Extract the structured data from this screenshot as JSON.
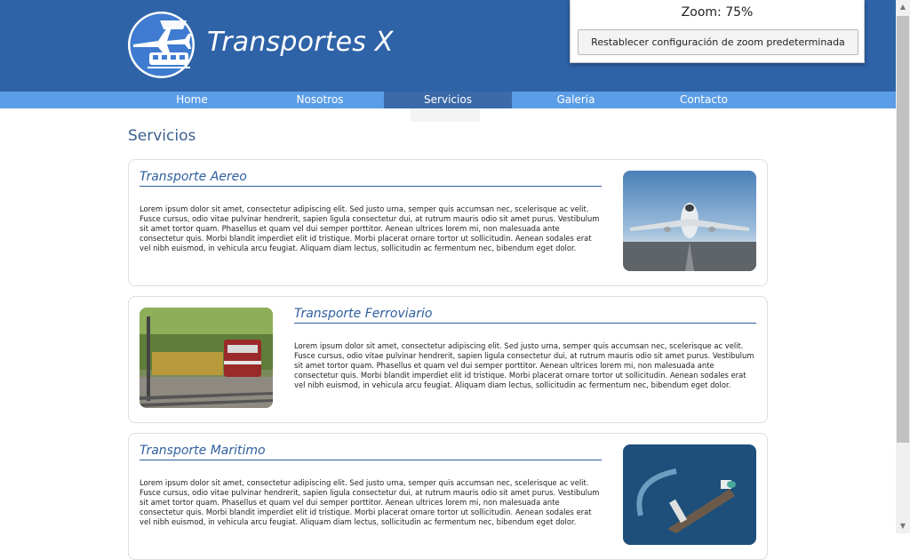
{
  "site": {
    "title": "Transportes X"
  },
  "nav": {
    "items": [
      "Home",
      "Nosotros",
      "Servicios",
      "Galeria",
      "Contacto"
    ],
    "active": "Servicios"
  },
  "page": {
    "heading": "Servicios"
  },
  "cards": [
    {
      "title": "Transporte Aereo",
      "text": "Lorem ipsum dolor sit amet, consectetur adipiscing elit. Sed justo urna, semper quis accumsan nec, scelerisque ac velit. Fusce cursus, odio vitae pulvinar hendrerit, sapien ligula consectetur dui, at rutrum mauris odio sit amet purus. Vestibulum sit amet tortor quam. Phasellus et quam vel dui semper porttitor. Aenean ultrices lorem mi, non malesuada ante consectetur quis. Morbi blandit imperdiet elit id tristique. Morbi placerat ornare tortor ut sollicitudin. Aenean sodales erat vel nibh euismod, in vehicula arcu feugiat. Aliquam diam lectus, sollicitudin ac fermentum nec, bibendum eget dolor.",
      "image": "airplane"
    },
    {
      "title": "Transporte Ferroviario",
      "text": "Lorem ipsum dolor sit amet, consectetur adipiscing elit. Sed justo urna, semper quis accumsan nec, scelerisque ac velit. Fusce cursus, odio vitae pulvinar hendrerit, sapien ligula consectetur dui, at rutrum mauris odio sit amet purus. Vestibulum sit amet tortor quam. Phasellus et quam vel dui semper porttitor. Aenean ultrices lorem mi, non malesuada ante consectetur quis. Morbi blandit imperdiet elit id tristique. Morbi placerat ornare tortor ut sollicitudin. Aenean sodales erat vel nibh euismod, in vehicula arcu feugiat. Aliquam diam lectus, sollicitudin ac fermentum nec, bibendum eget dolor.",
      "image": "train"
    },
    {
      "title": "Transporte Maritimo",
      "text": "Lorem ipsum dolor sit amet, consectetur adipiscing elit. Sed justo urna, semper quis accumsan nec, scelerisque ac velit. Fusce cursus, odio vitae pulvinar hendrerit, sapien ligula consectetur dui, at rutrum mauris odio sit amet purus. Vestibulum sit amet tortor quam. Phasellus et quam vel dui semper porttitor. Aenean ultrices lorem mi, non malesuada ante consectetur quis. Morbi blandit imperdiet elit id tristique. Morbi placerat ornare tortor ut sollicitudin. Aenean sodales erat vel nibh euismod, in vehicula arcu feugiat. Aliquam diam lectus, sollicitudin ac fermentum nec, bibendum eget dolor.",
      "image": "ship"
    }
  ],
  "zoom_popup": {
    "label": "Zoom: 75%",
    "reset_button": "Restablecer configuración de zoom predeterminada"
  },
  "colors": {
    "header": "#2f63a8",
    "nav": "#5b9de6",
    "nav_active": "#3b6aa8",
    "accent_text": "#2f5f9f"
  }
}
